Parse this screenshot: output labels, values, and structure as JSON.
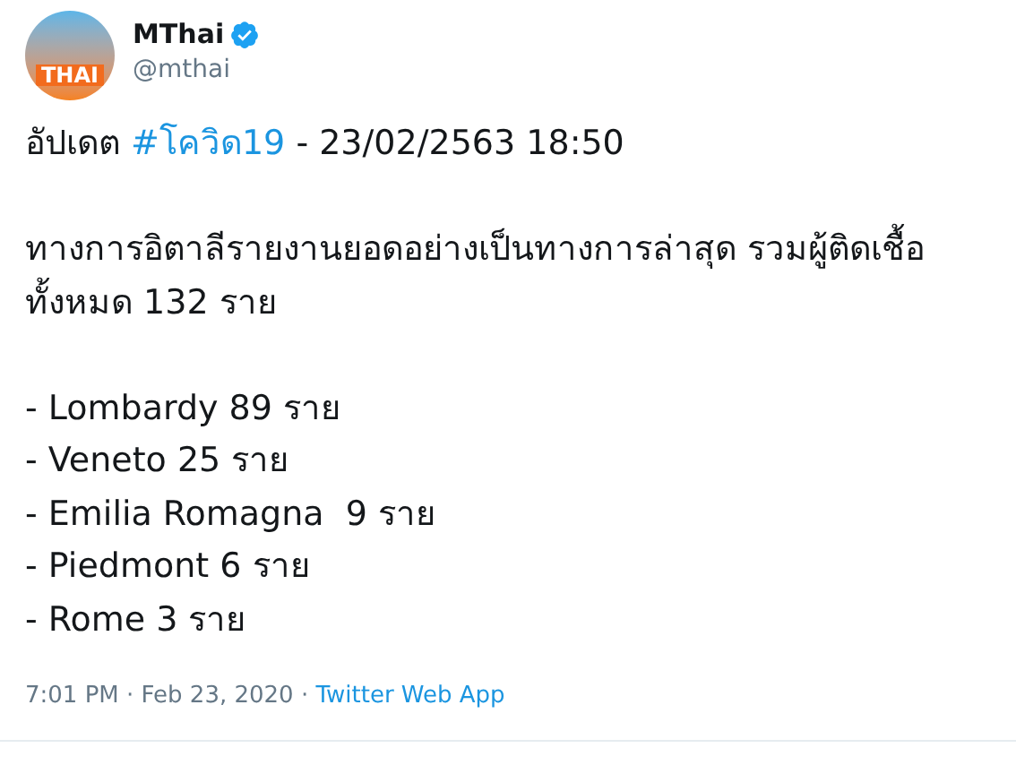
{
  "user": {
    "avatar_text": "THAI",
    "name": "MThai",
    "verified": true,
    "handle": "@mthai"
  },
  "tweet": {
    "headline": [
      {
        "text": "อัปเดต "
      },
      {
        "text": "#โควิด19",
        "kind": "hashtag"
      },
      {
        "text": " - 23/02/2563 18:50"
      }
    ],
    "paragraph": "ทางการอิตาลีรายงานยอดอย่างเป็นทางการล่าสุด รวมผู้ติดเชื้อทั้งหมด 132 ราย",
    "list": [
      "- Lombardy 89 ราย",
      "- Veneto 25 ราย",
      "- Emilia Romagna  9 ราย",
      "- Piedmont 6 ราย",
      "- Rome 3 ราย"
    ]
  },
  "meta": {
    "timestamp": "7:01 PM · Feb 23, 2020 · ",
    "source": "Twitter Web App"
  }
}
